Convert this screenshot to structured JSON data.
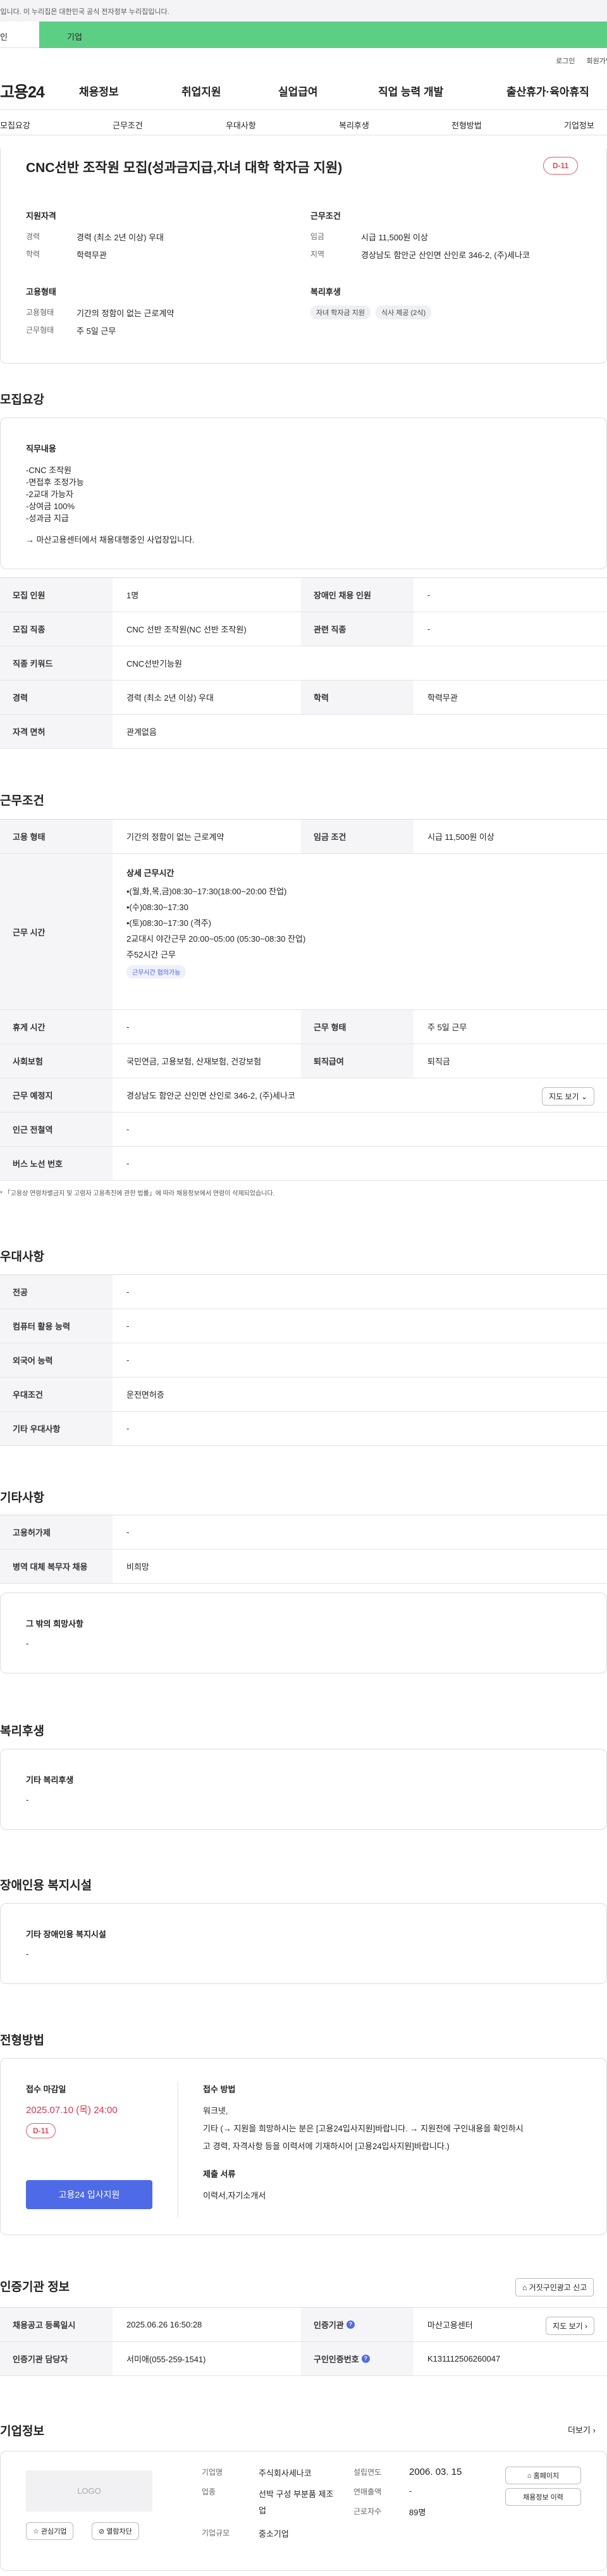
{
  "notice": "사이트입니다. 이 누리집은 대한민국 공식 전자정부 누리집입니다.",
  "tabs": [
    "인",
    "기업"
  ],
  "top_links": [
    "로그인",
    "회원가입"
  ],
  "logo": "고용24",
  "gnb": [
    "채용정보",
    "취업지원",
    "실업급여",
    "직업 능력 개발",
    "출산휴가·육아휴직"
  ],
  "subnav": [
    "모집요강",
    "근무조건",
    "우대사항",
    "복리후생",
    "전형방법",
    "기업정보"
  ],
  "job": {
    "title": "CNC선반 조작원 모집(성과금지급,자녀 대학 학자금 지원)",
    "dday": "D-11",
    "qual_h": "지원자격",
    "career_l": "경력",
    "career_v": "경력 (최소 2년 이상) 우대",
    "edu_l": "학력",
    "edu_v": "학력무관",
    "cond_h": "근무조건",
    "wage_l": "임금",
    "wage_v": "시급 11,500원 이상",
    "area_l": "지역",
    "area_v": "경상남도 함안군 산인면 산인로 346-2, (주)세나코",
    "emp_h": "고용형태",
    "etype_l": "고용형태",
    "etype_v": "기간의 정함이 없는 근로계약",
    "wtype_l": "근무형태",
    "wtype_v": "주 5일 근무",
    "welf_h": "복리후생",
    "chips": [
      "자녀 학자금 지원",
      "식사 제공 (2식)"
    ]
  },
  "recruit": {
    "title": "모집요강",
    "duty_h": "직무내용",
    "duty_lines": [
      "-CNC 조작원",
      "-면접후 조정가능",
      "-2교대 가능자",
      "-상여금 100%",
      "-성과금 지급",
      "→ 마산고용센터에서 채용대행중인 사업장입니다."
    ],
    "rows": [
      [
        "모집 인원",
        "1명",
        "장애인 채용 인원",
        "-"
      ],
      [
        "모집 직종",
        "CNC 선반 조작원(NC 선반 조작원)",
        "관련 직종",
        "-"
      ],
      [
        "직종 키워드",
        "CNC선반기능원",
        "",
        ""
      ],
      [
        "경력",
        "경력 (최소 2년 이상) 우대",
        "학력",
        "학력무관"
      ],
      [
        "자격 면허",
        "관계없음",
        "",
        ""
      ]
    ]
  },
  "work": {
    "title": "근무조건",
    "r1": [
      "고용 형태",
      "기간의 정함이 없는 근로계약",
      "임금 조건",
      "시급 11,500원 이상"
    ],
    "time_l": "근무 시간",
    "time_h": "상세 근무시간",
    "time_lines": [
      "•(월,화,목,금)08:30~17:30(18:00~20:00 잔업)",
      "•(수)08:30~17:30",
      "•(토)08:30~17:30 (격주)",
      "2교대시 야간근무 20:00~05:00 (05:30~08:30 잔업)",
      "주52시간 근무"
    ],
    "time_chip": "근무시간 협의가능",
    "r3": [
      "휴게 시간",
      "-",
      "근무 형태",
      "주 5일 근무"
    ],
    "r4": [
      "사회보험",
      "국민연금, 고용보험, 산재보험, 건강보험",
      "퇴직급여",
      "퇴직금"
    ],
    "r5": [
      "근무 예정지",
      "경상남도 함안군 산인면 산인로 346-2, (주)세나코"
    ],
    "map_btn": "지도 보기",
    "r6": [
      "인근 전철역",
      "-"
    ],
    "r7": [
      "버스 노선 번호",
      "-"
    ],
    "note": "* 「고용상 연령차별금지 및 고령자 고용촉진에 관한 법률」에 따라 채용정보에서 연령이 삭제되었습니다."
  },
  "pref": {
    "title": "우대사항",
    "rows": [
      [
        "전공",
        "-"
      ],
      [
        "컴퓨터 활용 능력",
        "-"
      ],
      [
        "외국어 능력",
        "-"
      ],
      [
        "우대조건",
        "운전면허증"
      ],
      [
        "기타 우대사항",
        "-"
      ]
    ]
  },
  "etc": {
    "title": "기타사항",
    "rows": [
      [
        "고용허가제",
        "-"
      ],
      [
        "병역 대체 복무자 채용",
        "비희망"
      ]
    ],
    "hope_h": "그 밖의 희망사항",
    "hope_v": "-"
  },
  "welfare": {
    "title": "복리후생",
    "h": "기타 복리후생",
    "v": "-"
  },
  "disab": {
    "title": "장애인용 복지시설",
    "h": "기타 장애인용 복지시설",
    "v": "-"
  },
  "apply": {
    "title": "전형방법",
    "deadline_h": "접수 마감일",
    "deadline": "2025.07.10 (목) 24:00",
    "dday": "D-11",
    "btn": "고용24 입사지원",
    "method_h": "접수 방법",
    "method_lines": [
      "워크넷,",
      "기타 (→ 지원을 희망하시는 분은 [고용24입사지원]바랍니다. → 지원전에 구인내용을 확인하시",
      "고 경력, 자격사항 등을 이력서에 기재하시어 [고용24입사지원]바랍니다.)"
    ],
    "docs_h": "제출 서류",
    "docs_v": "이력서,자기소개서"
  },
  "cert": {
    "title": "인증기관 정보",
    "report_btn": "거짓구인광고 신고",
    "r1": [
      "채용공고 등록일시",
      "2025.06.26 16:50:28",
      "인증기관",
      "마산고용센터"
    ],
    "map_btn": "지도 보기",
    "r2": [
      "인증기관 담당자",
      "서미애(055-259-1541)",
      "구인인증번호",
      "K131112506260047"
    ]
  },
  "company": {
    "title": "기업정보",
    "more": "더보기",
    "logo": "LOGO",
    "fav": "관심기업",
    "block": "열람차단",
    "info": [
      [
        "기업명",
        "주식회사세나코"
      ],
      [
        "업종",
        "선박 구성 부분품 제조업"
      ],
      [
        "기업규모",
        "중소기업"
      ]
    ],
    "info2": [
      [
        "설립연도",
        "2006. 03. 15"
      ],
      [
        "연매출액",
        "-"
      ],
      [
        "근로자수",
        "89명"
      ]
    ],
    "home_btn": "홈페이지",
    "jobs_btn": "채용정보 이력"
  }
}
